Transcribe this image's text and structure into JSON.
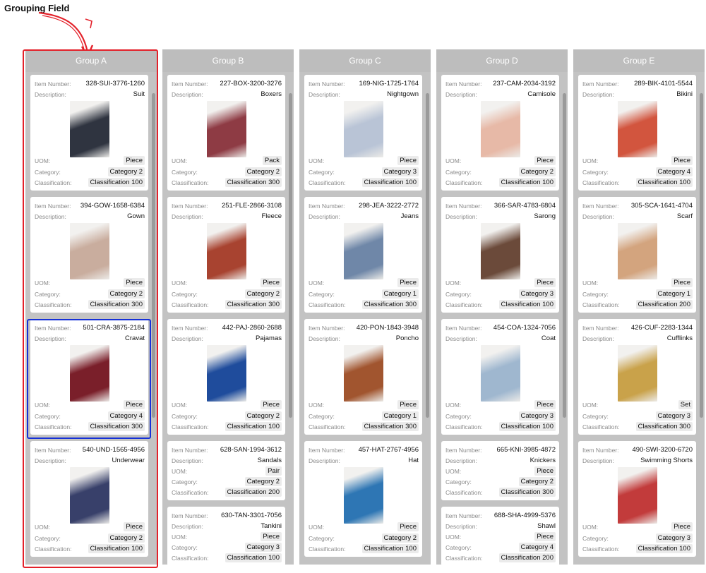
{
  "annotation": "Grouping Field",
  "groups": [
    {
      "name": "Group A",
      "cards": [
        {
          "item_label": "Item Number:",
          "item": "328-SUI-3776-1260",
          "desc_label": "Description:",
          "desc": "Suit",
          "uom_label": "UOM:",
          "uom": "Piece",
          "cat_label": "Category:",
          "cat": "Category 2",
          "cls_label": "Classification:",
          "cls": "Classification 100",
          "img": "suit"
        },
        {
          "item_label": "Item Number:",
          "item": "394-GOW-1658-6384",
          "desc_label": "Description:",
          "desc": "Gown",
          "uom_label": "UOM:",
          "uom": "Piece",
          "cat_label": "Category:",
          "cat": "Category 2",
          "cls_label": "Classification:",
          "cls": "Classification 300",
          "img": "gown"
        },
        {
          "item_label": "Item Number:",
          "item": "501-CRA-3875-2184",
          "desc_label": "Description:",
          "desc": "Cravat",
          "uom_label": "UOM:",
          "uom": "Piece",
          "cat_label": "Category:",
          "cat": "Category 4",
          "cls_label": "Classification:",
          "cls": "Classification 300",
          "img": "cravat"
        },
        {
          "item_label": "Item Number:",
          "item": "540-UND-1565-4956",
          "desc_label": "Description:",
          "desc": "Underwear",
          "uom_label": "UOM:",
          "uom": "Piece",
          "cat_label": "Category:",
          "cat": "Category 2",
          "cls_label": "Classification:",
          "cls": "Classification 100",
          "img": "underwear"
        }
      ]
    },
    {
      "name": "Group B",
      "cards": [
        {
          "item_label": "Item Number:",
          "item": "227-BOX-3200-3276",
          "desc_label": "Description:",
          "desc": "Boxers",
          "uom_label": "UOM:",
          "uom": "Pack",
          "cat_label": "Category:",
          "cat": "Category 2",
          "cls_label": "Classification:",
          "cls": "Classification 300",
          "img": "boxers"
        },
        {
          "item_label": "Item Number:",
          "item": "251-FLE-2866-3108",
          "desc_label": "Description:",
          "desc": "Fleece",
          "uom_label": "UOM:",
          "uom": "Piece",
          "cat_label": "Category:",
          "cat": "Category 2",
          "cls_label": "Classification:",
          "cls": "Classification 300",
          "img": "fleece"
        },
        {
          "item_label": "Item Number:",
          "item": "442-PAJ-2860-2688",
          "desc_label": "Description:",
          "desc": "Pajamas",
          "uom_label": "UOM:",
          "uom": "Piece",
          "cat_label": "Category:",
          "cat": "Category 2",
          "cls_label": "Classification:",
          "cls": "Classification 100",
          "img": "pajamas"
        },
        {
          "item_label": "Item Number:",
          "item": "628-SAN-1994-3612",
          "desc_label": "Description:",
          "desc": "Sandals",
          "uom_label": "UOM:",
          "uom": "Pair",
          "cat_label": "Category:",
          "cat": "Category 2",
          "cls_label": "Classification:",
          "cls": "Classification 200",
          "img": ""
        },
        {
          "item_label": "Item Number:",
          "item": "630-TAN-3301-7056",
          "desc_label": "Description:",
          "desc": "Tankini",
          "uom_label": "UOM:",
          "uom": "Piece",
          "cat_label": "Category:",
          "cat": "Category 3",
          "cls_label": "Classification:",
          "cls": "Classification 100",
          "img": ""
        }
      ]
    },
    {
      "name": "Group C",
      "cards": [
        {
          "item_label": "Item Number:",
          "item": "169-NIG-1725-1764",
          "desc_label": "Description:",
          "desc": "Nightgown",
          "uom_label": "UOM:",
          "uom": "Piece",
          "cat_label": "Category:",
          "cat": "Category 3",
          "cls_label": "Classification:",
          "cls": "Classification 100",
          "img": "nightgown"
        },
        {
          "item_label": "Item Number:",
          "item": "298-JEA-3222-2772",
          "desc_label": "Description:",
          "desc": "Jeans",
          "uom_label": "UOM:",
          "uom": "Piece",
          "cat_label": "Category:",
          "cat": "Category 1",
          "cls_label": "Classification:",
          "cls": "Classification 300",
          "img": "jeans"
        },
        {
          "item_label": "Item Number:",
          "item": "420-PON-1843-3948",
          "desc_label": "Description:",
          "desc": "Poncho",
          "uom_label": "UOM:",
          "uom": "Piece",
          "cat_label": "Category:",
          "cat": "Category 1",
          "cls_label": "Classification:",
          "cls": "Classification 300",
          "img": "poncho"
        },
        {
          "item_label": "Item Number:",
          "item": "457-HAT-2767-4956",
          "desc_label": "Description:",
          "desc": "Hat",
          "uom_label": "UOM:",
          "uom": "Piece",
          "cat_label": "Category:",
          "cat": "Category 2",
          "cls_label": "Classification:",
          "cls": "Classification 100",
          "img": "hat"
        }
      ]
    },
    {
      "name": "Group D",
      "cards": [
        {
          "item_label": "Item Number:",
          "item": "237-CAM-2034-3192",
          "desc_label": "Description:",
          "desc": "Camisole",
          "uom_label": "UOM:",
          "uom": "Piece",
          "cat_label": "Category:",
          "cat": "Category 2",
          "cls_label": "Classification:",
          "cls": "Classification 100",
          "img": "camisole"
        },
        {
          "item_label": "Item Number:",
          "item": "366-SAR-4783-6804",
          "desc_label": "Description:",
          "desc": "Sarong",
          "uom_label": "UOM:",
          "uom": "Piece",
          "cat_label": "Category:",
          "cat": "Category 3",
          "cls_label": "Classification:",
          "cls": "Classification 100",
          "img": "sarong"
        },
        {
          "item_label": "Item Number:",
          "item": "454-COA-1324-7056",
          "desc_label": "Description:",
          "desc": "Coat",
          "uom_label": "UOM:",
          "uom": "Piece",
          "cat_label": "Category:",
          "cat": "Category 3",
          "cls_label": "Classification:",
          "cls": "Classification 100",
          "img": "coat"
        },
        {
          "item_label": "Item Number:",
          "item": "665-KNI-3985-4872",
          "desc_label": "Description:",
          "desc": "Knickers",
          "uom_label": "UOM:",
          "uom": "Piece",
          "cat_label": "Category:",
          "cat": "Category 2",
          "cls_label": "Classification:",
          "cls": "Classification 300",
          "img": ""
        },
        {
          "item_label": "Item Number:",
          "item": "688-SHA-4999-5376",
          "desc_label": "Description:",
          "desc": "Shawl",
          "uom_label": "UOM:",
          "uom": "Piece",
          "cat_label": "Category:",
          "cat": "Category 4",
          "cls_label": "Classification:",
          "cls": "Classification 200",
          "img": ""
        }
      ]
    },
    {
      "name": "Group E",
      "cards": [
        {
          "item_label": "Item Number:",
          "item": "289-BIK-4101-5544",
          "desc_label": "Description:",
          "desc": "Bikini",
          "uom_label": "UOM:",
          "uom": "Piece",
          "cat_label": "Category:",
          "cat": "Category 4",
          "cls_label": "Classification:",
          "cls": "Classification 100",
          "img": "bikini"
        },
        {
          "item_label": "Item Number:",
          "item": "305-SCA-1641-4704",
          "desc_label": "Description:",
          "desc": "Scarf",
          "uom_label": "UOM:",
          "uom": "Piece",
          "cat_label": "Category:",
          "cat": "Category 1",
          "cls_label": "Classification:",
          "cls": "Classification 200",
          "img": "scarf"
        },
        {
          "item_label": "Item Number:",
          "item": "426-CUF-2283-1344",
          "desc_label": "Description:",
          "desc": "Cufflinks",
          "uom_label": "UOM:",
          "uom": "Set",
          "cat_label": "Category:",
          "cat": "Category 3",
          "cls_label": "Classification:",
          "cls": "Classification 300",
          "img": "cufflinks"
        },
        {
          "item_label": "Item Number:",
          "item": "490-SWI-3200-6720",
          "desc_label": "Description:",
          "desc": "Swimming Shorts",
          "uom_label": "UOM:",
          "uom": "Piece",
          "cat_label": "Category:",
          "cat": "Category 3",
          "cls_label": "Classification:",
          "cls": "Classification 100",
          "img": "swim"
        }
      ]
    }
  ],
  "image_palette": {
    "suit": "#2f3440",
    "gown": "#c9ad9e",
    "cravat": "#7a1f2a",
    "underwear": "#38406a",
    "boxers": "#8e3b44",
    "fleece": "#a84330",
    "pajamas": "#1f4c9c",
    "nightgown": "#b9c4d6",
    "jeans": "#6f87a8",
    "poncho": "#a1552f",
    "hat": "#2e76b4",
    "camisole": "#e7b9a7",
    "sarong": "#6b4a3a",
    "coat": "#9fb7cf",
    "bikini": "#d2553e",
    "scarf": "#d3a47e",
    "cufflinks": "#c9a24a",
    "swim": "#c23b3b"
  }
}
